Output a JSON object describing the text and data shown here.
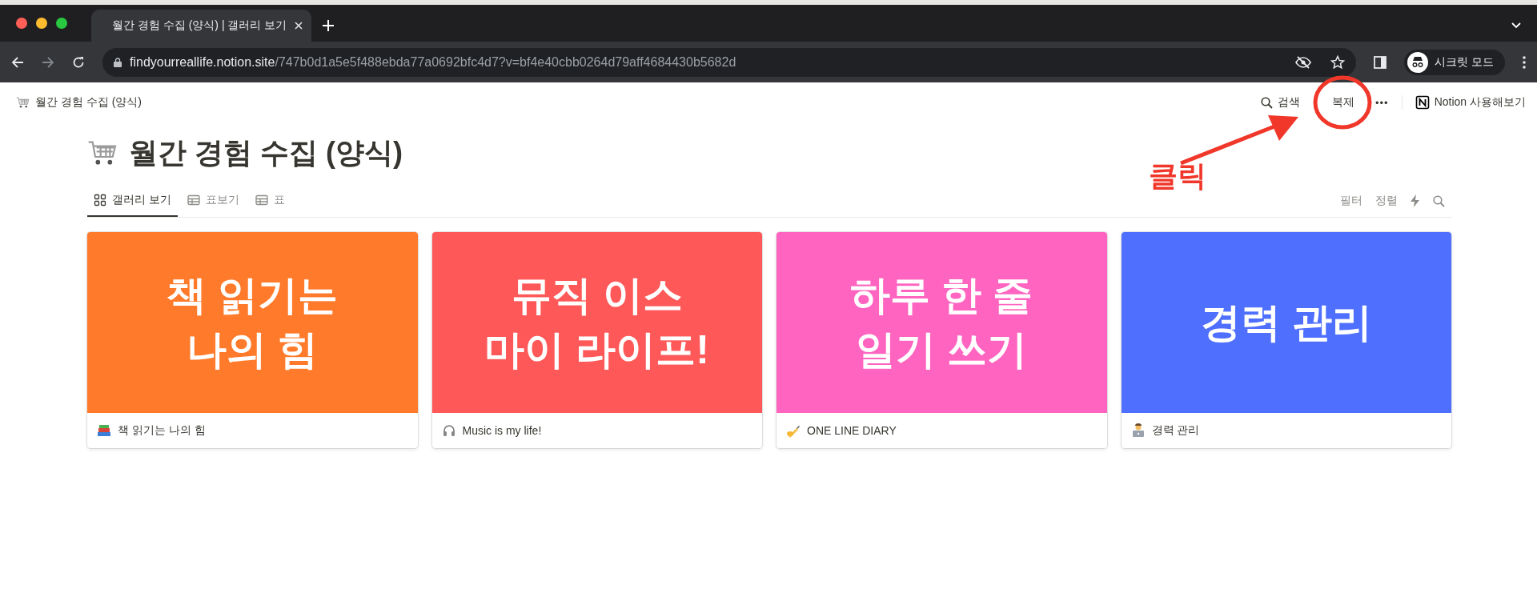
{
  "browser": {
    "tab": {
      "title": "월간 경험 수집 (양식) | 갤러리 보기",
      "selected": true
    },
    "url_host": "findyourreallife.notion.site",
    "url_path": "/747b0d1a5e5f488ebda77a0692bfc4d7?v=bf4e40cbb0264d79aff4684430b5682d",
    "profile_label": "시크릿 모드"
  },
  "topbar": {
    "breadcrumb": "월간 경험 수집 (양식)",
    "search_label": "검색",
    "duplicate_label": "복제",
    "more_label": "•••",
    "notion_label": "Notion 사용해보기"
  },
  "page": {
    "title": "월간 경험 수집 (양식)"
  },
  "views": [
    {
      "label": "갤러리 보기",
      "kind": "gallery",
      "selected": true
    },
    {
      "label": "표보기",
      "kind": "table",
      "selected": false
    },
    {
      "label": "표",
      "kind": "table",
      "selected": false
    }
  ],
  "view_actions": {
    "filter": "필터",
    "sort": "정렬"
  },
  "cards": [
    {
      "cover_lines": [
        "책 읽기는",
        "나의 힘"
      ],
      "color": "#ff7a2a",
      "kind": "books",
      "title": "책 읽기는 나의 힘"
    },
    {
      "cover_lines": [
        "뮤직 이스",
        "마이 라이프!"
      ],
      "color": "#ff5858",
      "kind": "headphones",
      "title": "Music is my life!"
    },
    {
      "cover_lines": [
        "하루 한 줄",
        "일기 쓰기"
      ],
      "color": "#ff64c0",
      "kind": "writing",
      "title": "ONE LINE DIARY"
    },
    {
      "cover_lines": [
        "경력 관리"
      ],
      "color": "#4f6ffe",
      "kind": "worker",
      "title": "경력 관리"
    }
  ],
  "annotation": {
    "label": "클릭"
  }
}
